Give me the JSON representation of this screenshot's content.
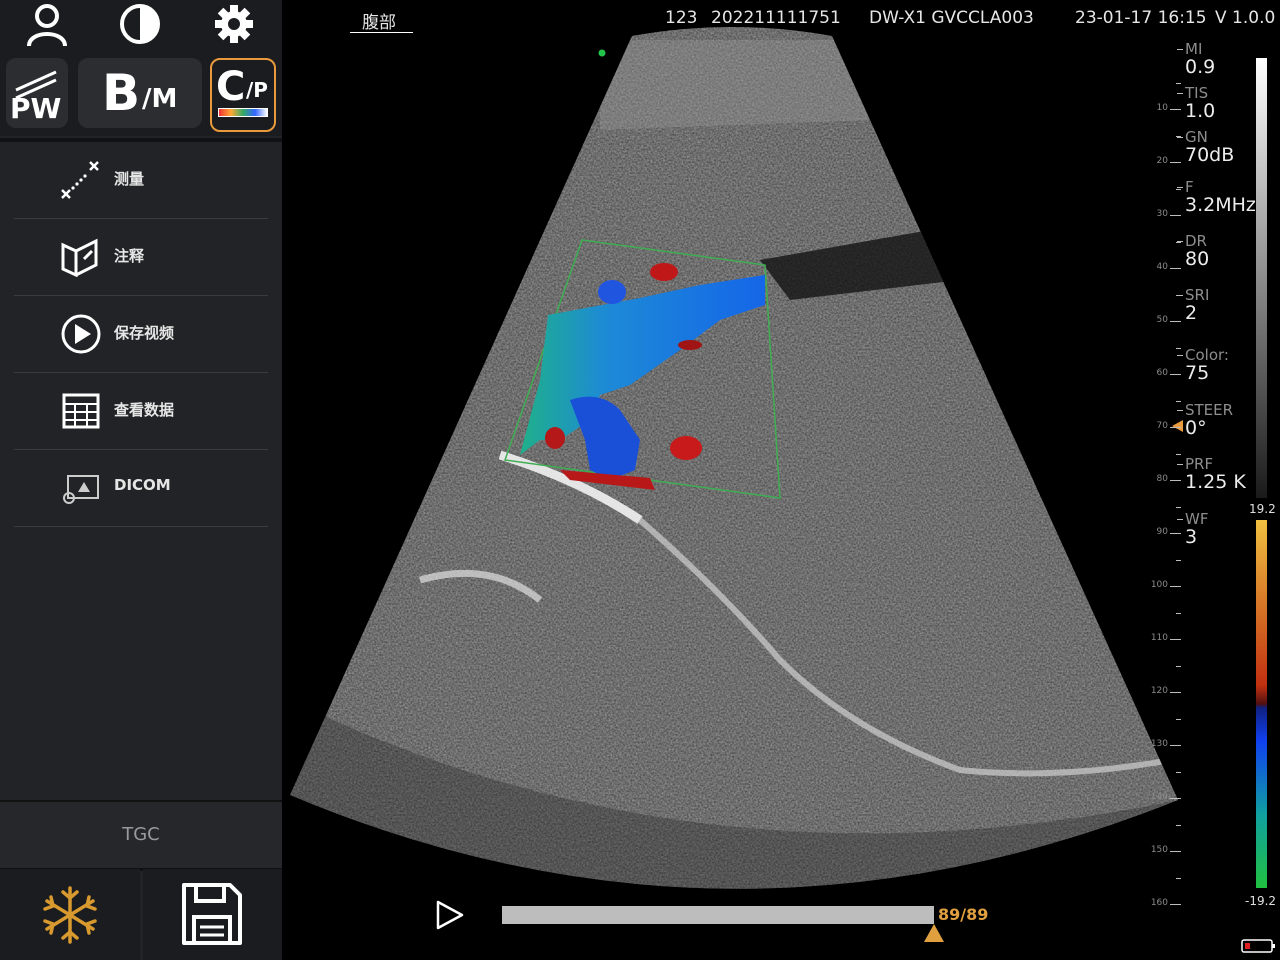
{
  "sidebar": {
    "top_icons": [
      "user-icon",
      "contrast-icon",
      "gear-icon"
    ],
    "modes": {
      "pw": "PW",
      "bm_b": "B",
      "bm_m": "/M",
      "cp_c": "C",
      "cp_p": "/P"
    },
    "menu": [
      {
        "label": "测量",
        "icon": "measure-icon"
      },
      {
        "label": "注释",
        "icon": "annotate-icon"
      },
      {
        "label": "保存视频",
        "icon": "play-circle-icon"
      },
      {
        "label": "查看数据",
        "icon": "table-icon"
      },
      {
        "label": "DICOM",
        "icon": "dicom-icon"
      }
    ],
    "tgc": "TGC",
    "freeze_icon": "snowflake-icon",
    "save_icon": "floppy-disk-icon"
  },
  "header": {
    "exam": "腹部",
    "patient_id": "123",
    "study_id": "202211111751",
    "device": "DW-X1 GVCCLA003",
    "datetime": "23-01-17 16:15",
    "version": "V 1.0.0"
  },
  "params": [
    {
      "label": "MI",
      "value": "0.9"
    },
    {
      "label": "TIS",
      "value": "1.0"
    },
    {
      "label": "GN",
      "value": "70dB"
    },
    {
      "label": "F",
      "value": "3.2MHz"
    },
    {
      "label": "DR",
      "value": "80"
    },
    {
      "label": "SRI",
      "value": "2"
    },
    {
      "label": "Color:",
      "value": "75"
    },
    {
      "label": "STEER",
      "value": "0°"
    },
    {
      "label": "PRF",
      "value": "1.25 K"
    },
    {
      "label": "WF",
      "value": "3"
    }
  ],
  "depth_scale": [
    "10",
    "20",
    "30",
    "40",
    "50",
    "60",
    "70",
    "80",
    "90",
    "100",
    "110",
    "120",
    "130",
    "140",
    "150",
    "160"
  ],
  "color_scale": {
    "max": "19.2",
    "min": "-19.2"
  },
  "cine": {
    "frame_label": "89/89",
    "progress": 1.0
  },
  "colors": {
    "accent": "#e89a3c",
    "sidebar": "#222326"
  }
}
